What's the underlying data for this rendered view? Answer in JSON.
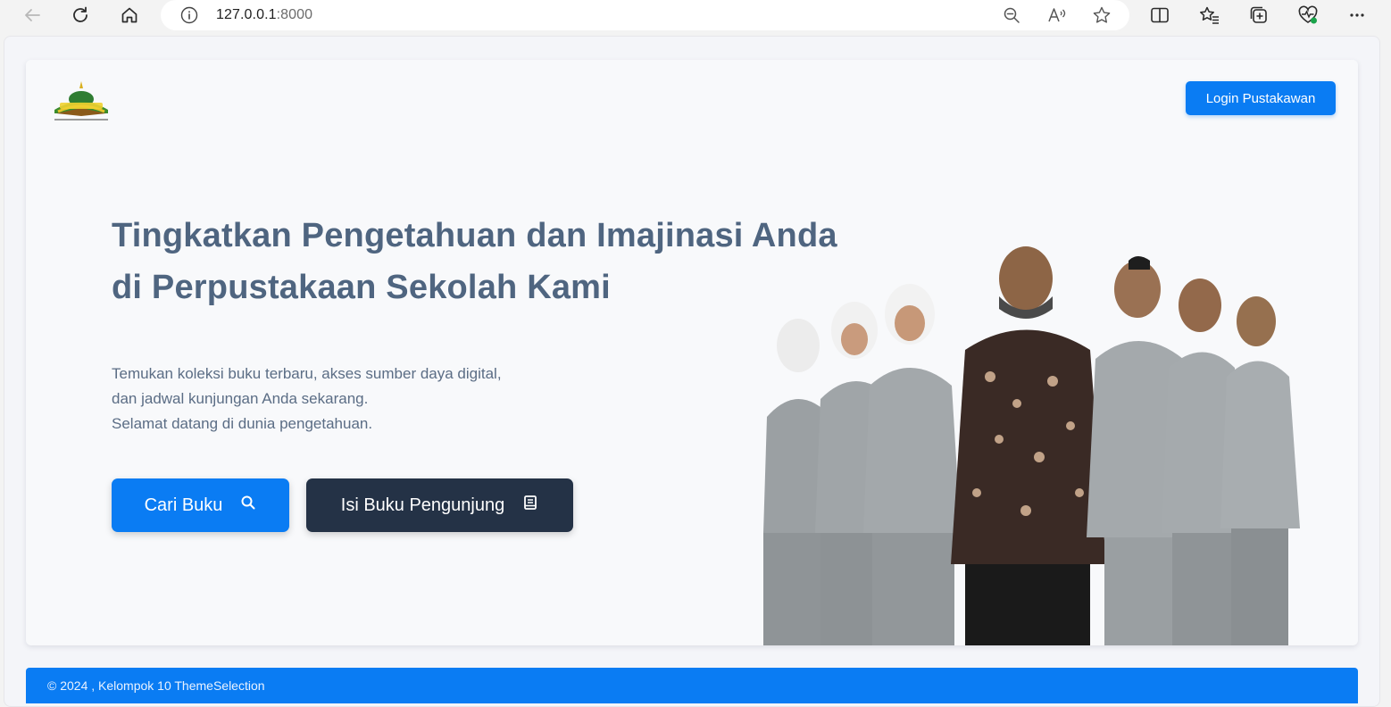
{
  "browser": {
    "url_host": "127.0.0.1",
    "url_port": ":8000",
    "icons": [
      "back-arrow-icon",
      "refresh-icon",
      "home-icon",
      "site-info-icon",
      "zoom-out-icon",
      "read-aloud-icon",
      "favorite-star-icon",
      "split-screen-icon",
      "favorites-icon",
      "collections-icon",
      "browser-essentials-icon",
      "more-menu-icon"
    ]
  },
  "header": {
    "logo_alt": "school-logo",
    "login_label": "Login Pustakawan"
  },
  "hero": {
    "headline_line1": "Tingkatkan Pengetahuan dan Imajinasi Anda",
    "headline_line2": "di Perpustakaan Sekolah Kami",
    "sub_line1": "Temukan koleksi buku terbaru, akses sumber daya digital,",
    "sub_line2": "dan jadwal kunjungan Anda sekarang.",
    "sub_line3": "Selamat datang di dunia pengetahuan.",
    "search_button": "Cari Buku",
    "guestbook_button": "Isi Buku Pengunjung"
  },
  "footer": {
    "text": "© 2024 , Kelompok 10 ThemeSelection"
  },
  "colors": {
    "primary": "#0a7cf3",
    "dark_button": "#243246",
    "headline": "#4f6580"
  }
}
